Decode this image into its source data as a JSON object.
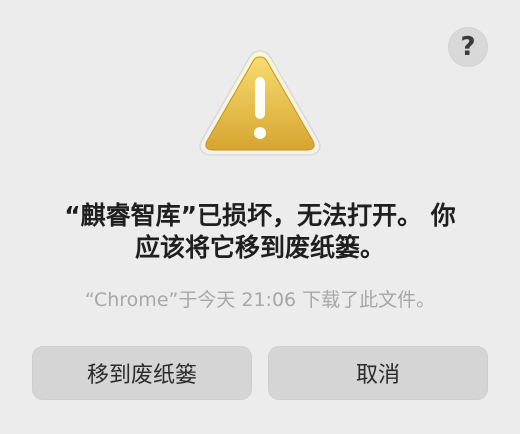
{
  "dialog": {
    "help_label": "?",
    "title_line1": "“麒睿智库”已损坏，无法打开。 你",
    "title_line2": "应该将它移到废纸篓。",
    "subtitle": "“Chrome”于今天 21:06 下载了此文件。",
    "icon": "warning-triangle-icon"
  },
  "buttons": {
    "move_to_trash": "移到废纸篓",
    "cancel": "取消"
  },
  "colors": {
    "background": "#ececec",
    "warning_fill_top": "#f6d86b",
    "warning_fill_bottom": "#d8a72e",
    "button_bg": "#d5d5d5"
  }
}
